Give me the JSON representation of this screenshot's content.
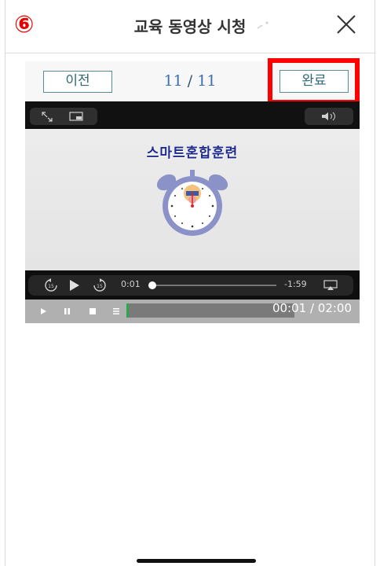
{
  "step_marker": "⑥",
  "header": {
    "title": "교육 동영상 시청",
    "close_icon": "close-icon"
  },
  "nav": {
    "prev_label": "이전",
    "current_page": "11",
    "separator": "/",
    "total_pages": "11",
    "done_label": "완료",
    "highlight_color": "#ff0000"
  },
  "video": {
    "slide_title": "스마트혼합훈련",
    "elapsed": "0:01",
    "remaining": "-1:59",
    "progress": 0.01,
    "icons": [
      "expand-icon",
      "pip-icon",
      "volume-icon",
      "rewind-15-icon",
      "play-icon",
      "forward-15-icon",
      "airplay-icon"
    ]
  },
  "player": {
    "time_display": "00:01 / 02:00",
    "progress": 0.01,
    "progress_color": "#2aa84a",
    "icons": [
      "play-icon",
      "pause-icon",
      "stop-icon",
      "menu-icon"
    ]
  }
}
